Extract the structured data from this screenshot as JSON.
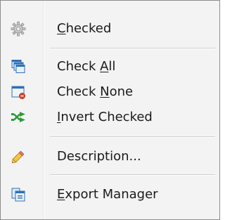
{
  "menu": {
    "items": [
      {
        "id": "checked",
        "pre": "",
        "accel": "C",
        "post": "hecked",
        "icon": "gear-icon"
      },
      {
        "id": "check-all",
        "pre": "Check ",
        "accel": "A",
        "post": "ll",
        "icon": "windows-stack-icon"
      },
      {
        "id": "check-none",
        "pre": "Check ",
        "accel": "N",
        "post": "one",
        "icon": "window-with-red-badge-icon"
      },
      {
        "id": "invert-checked",
        "pre": "",
        "accel": "I",
        "post": "nvert Checked",
        "icon": "green-arrows-swap-icon"
      },
      {
        "id": "description",
        "pre": "Description...",
        "accel": "",
        "post": "",
        "icon": "pencil-icon"
      },
      {
        "id": "export-manager",
        "pre": "",
        "accel": "E",
        "post": "xport Manager",
        "icon": "export-manager-icon"
      }
    ]
  }
}
